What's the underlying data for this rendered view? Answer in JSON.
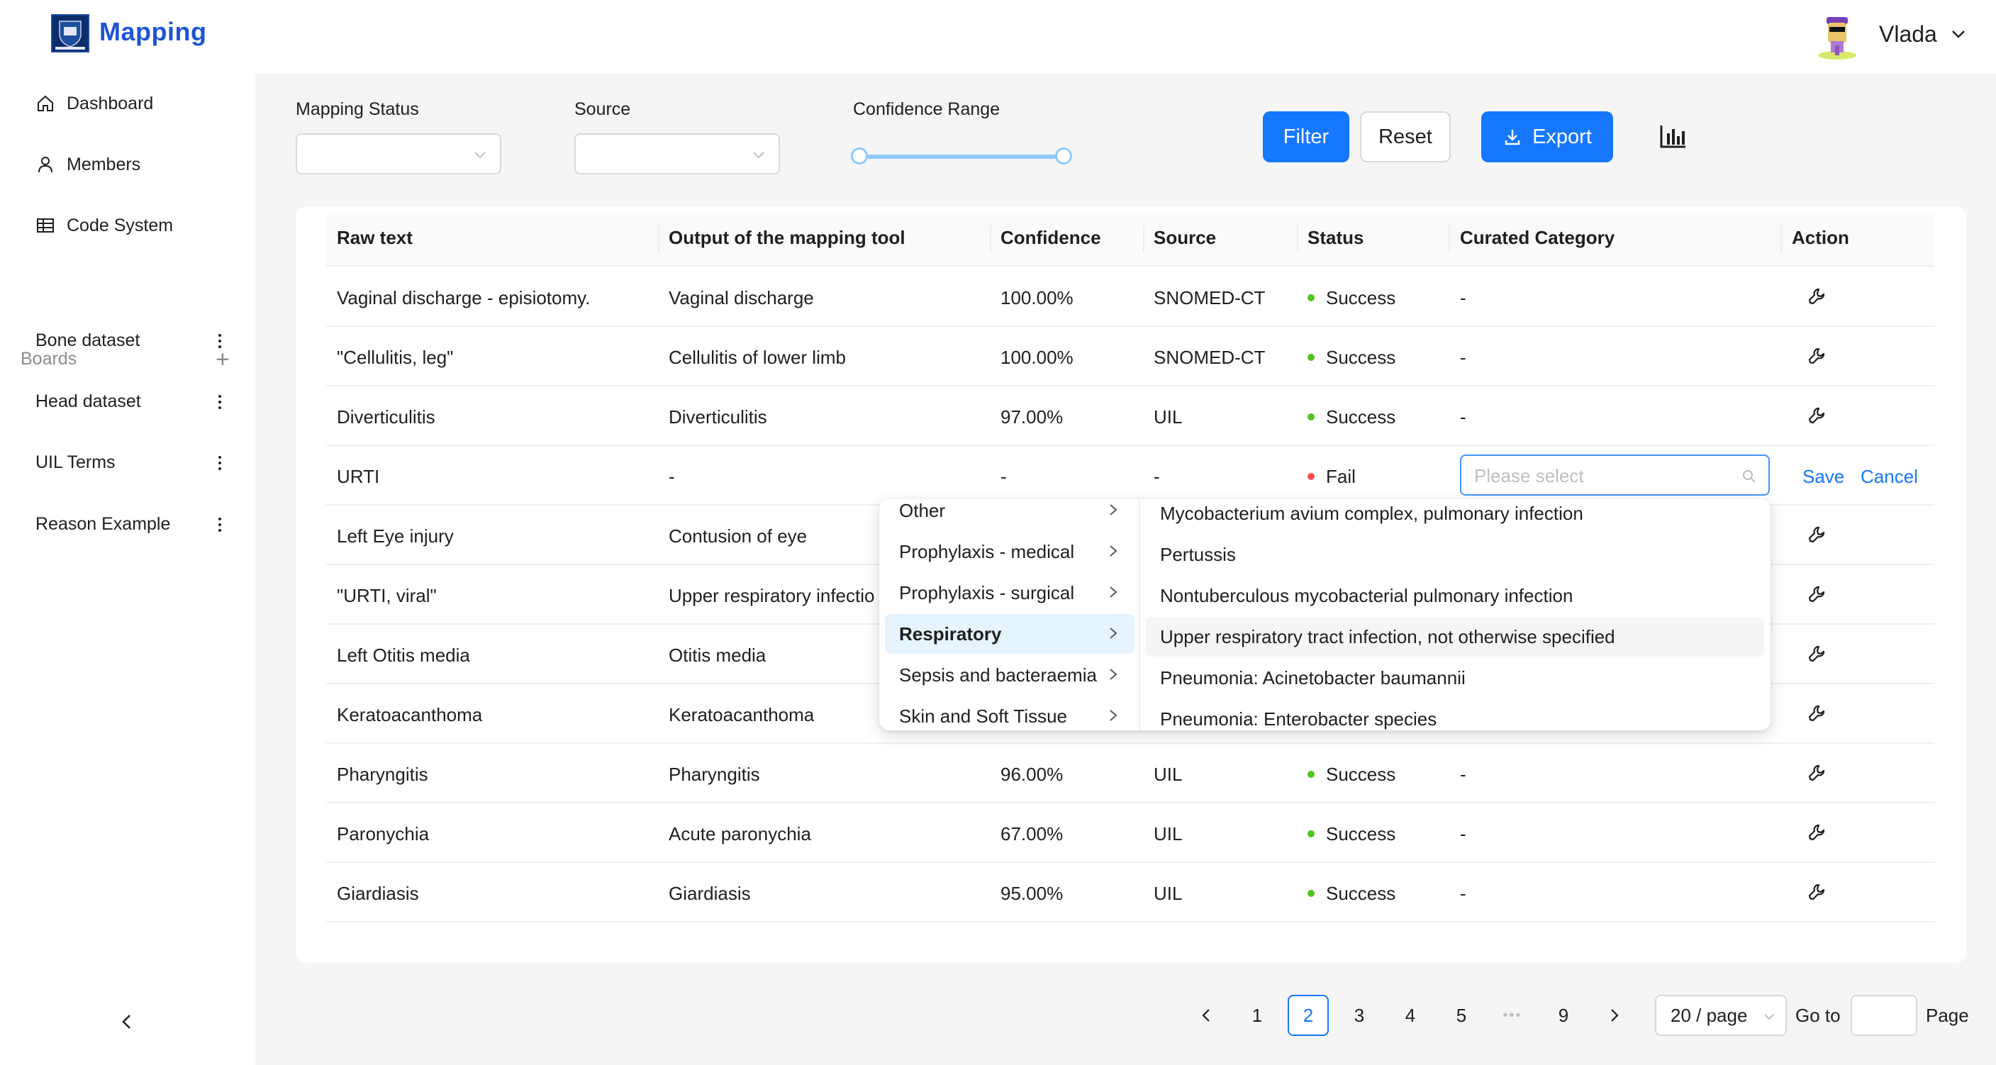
{
  "app": {
    "title": "Mapping",
    "user_name": "Vlada"
  },
  "sidebar": {
    "nav": [
      {
        "label": "Dashboard",
        "icon": "home-icon"
      },
      {
        "label": "Members",
        "icon": "user-icon"
      },
      {
        "label": "Code System",
        "icon": "table-icon"
      }
    ],
    "boards_label": "Boards",
    "boards_add": "+",
    "boards": [
      "Bone dataset",
      "Head dataset",
      "UIL Terms",
      "Reason Example"
    ]
  },
  "filters": {
    "mapping_status_label": "Mapping Status",
    "source_label": "Source",
    "confidence_label": "Confidence Range",
    "filter_button": "Filter",
    "reset_button": "Reset",
    "export_button": "Export"
  },
  "table": {
    "columns": [
      "Raw text",
      "Output of the mapping tool",
      "Confidence",
      "Source",
      "Status",
      "Curated Category",
      "Action"
    ],
    "rows": [
      {
        "raw": "Vaginal discharge - episiotomy.",
        "output": "Vaginal discharge",
        "confidence": "100.00%",
        "source": "SNOMED-CT",
        "status": "Success",
        "curated": "-"
      },
      {
        "raw": "\"Cellulitis, leg\"",
        "output": "Cellulitis of lower limb",
        "confidence": "100.00%",
        "source": "SNOMED-CT",
        "status": "Success",
        "curated": "-"
      },
      {
        "raw": "Diverticulitis",
        "output": "Diverticulitis",
        "confidence": "97.00%",
        "source": "UIL",
        "status": "Success",
        "curated": "-"
      },
      {
        "raw": "URTI",
        "output": "-",
        "confidence": "-",
        "source": "-",
        "status": "Fail",
        "curated": ""
      },
      {
        "raw": "Left Eye injury",
        "output": "Contusion of eye",
        "confidence": "",
        "source": "",
        "status": "",
        "curated": ""
      },
      {
        "raw": "\"URTI, viral\"",
        "output": "Upper respiratory infectio",
        "confidence": "",
        "source": "",
        "status": "",
        "curated": ""
      },
      {
        "raw": "Left Otitis media",
        "output": "Otitis media",
        "confidence": "",
        "source": "",
        "status": "",
        "curated": ""
      },
      {
        "raw": "Keratoacanthoma",
        "output": "Keratoacanthoma",
        "confidence": "",
        "source": "",
        "status": "",
        "curated": ""
      },
      {
        "raw": "Pharyngitis",
        "output": "Pharyngitis",
        "confidence": "96.00%",
        "source": "UIL",
        "status": "Success",
        "curated": "-"
      },
      {
        "raw": "Paronychia",
        "output": "Acute paronychia",
        "confidence": "67.00%",
        "source": "UIL",
        "status": "Success",
        "curated": "-"
      },
      {
        "raw": "Giardiasis",
        "output": "Giardiasis",
        "confidence": "95.00%",
        "source": "UIL",
        "status": "Success",
        "curated": "-"
      }
    ],
    "edit": {
      "placeholder": "Please select",
      "save": "Save",
      "cancel": "Cancel"
    }
  },
  "cascader": {
    "categories": [
      "Other",
      "Prophylaxis - medical",
      "Prophylaxis - surgical",
      "Respiratory",
      "Sepsis and bacteraemia",
      "Skin and Soft Tissue"
    ],
    "active_category": "Respiratory",
    "options": [
      "Mycobacterium avium complex, pulmonary infection",
      "Pertussis",
      "Nontuberculous mycobacterial pulmonary infection",
      "Upper respiratory tract infection, not otherwise specified",
      "Pneumonia: Acinetobacter baumannii",
      "Pneumonia: Enterobacter species"
    ],
    "hovered_option": "Upper respiratory tract infection, not otherwise specified"
  },
  "pagination": {
    "pages": [
      "1",
      "2",
      "3",
      "4",
      "5",
      "9"
    ],
    "current": "2",
    "ellipsis": "•••",
    "page_size": "20 / page",
    "goto_label": "Go to",
    "page_label": "Page"
  },
  "colors": {
    "primary": "#1677ff",
    "brand": "#1f54d6",
    "success": "#52c41a",
    "fail": "#ff4d4f"
  }
}
